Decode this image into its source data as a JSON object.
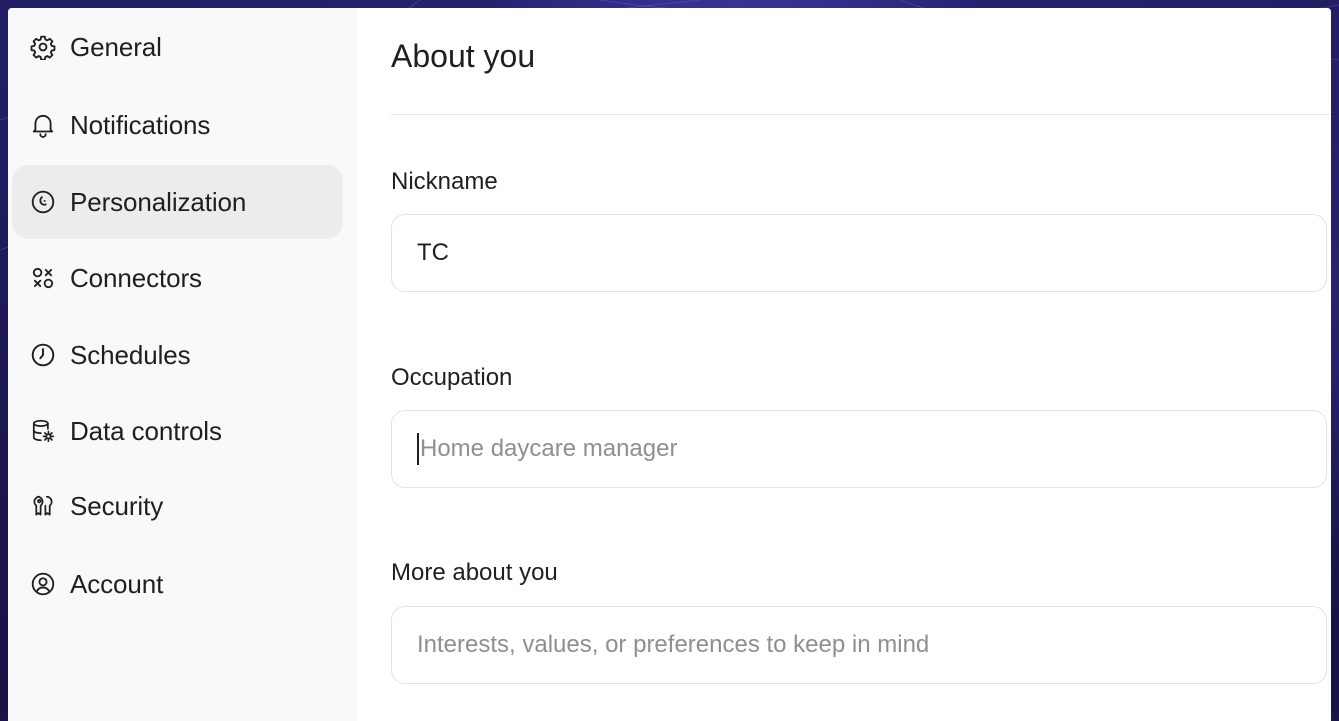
{
  "sidebar": {
    "items": [
      {
        "label": "General",
        "icon": "gear-icon",
        "active": false
      },
      {
        "label": "Notifications",
        "icon": "bell-icon",
        "active": false
      },
      {
        "label": "Personalization",
        "icon": "personalization-icon",
        "active": true
      },
      {
        "label": "Connectors",
        "icon": "connectors-icon",
        "active": false
      },
      {
        "label": "Schedules",
        "icon": "clock-icon",
        "active": false
      },
      {
        "label": "Data controls",
        "icon": "database-gear-icon",
        "active": false
      },
      {
        "label": "Security",
        "icon": "shield-key-icon",
        "active": false
      },
      {
        "label": "Account",
        "icon": "account-icon",
        "active": false
      }
    ]
  },
  "main": {
    "title": "About you",
    "fields": {
      "nickname": {
        "label": "Nickname",
        "value": "TC"
      },
      "occupation": {
        "label": "Occupation",
        "value": "",
        "placeholder": "Home daycare manager"
      },
      "more": {
        "label": "More about you",
        "value": "",
        "placeholder": "Interests, values, or preferences to keep in mind"
      }
    }
  },
  "colors": {
    "background": "#1a1647",
    "sidebar": "#f9f9f9",
    "active_item": "#ececec",
    "text": "#1f1f1f",
    "placeholder": "#8f8f8f",
    "border": "#e3e3e3"
  }
}
